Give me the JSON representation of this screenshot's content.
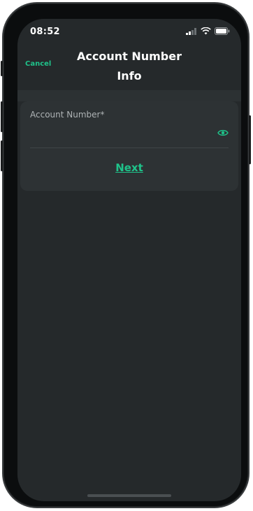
{
  "status_bar": {
    "time": "08:52"
  },
  "header": {
    "cancel_label": "Cancel",
    "title_line1": "Account Number",
    "title_line2": "Info"
  },
  "form": {
    "account_number_label": "Account Number*",
    "account_number_value": "",
    "next_label": "Next"
  },
  "colors": {
    "accent": "#1fc28a",
    "background": "#25292b",
    "card": "#2d3234"
  },
  "icons": {
    "visibility": "eye-icon",
    "signal": "cellular-signal-icon",
    "wifi": "wifi-icon",
    "battery": "battery-icon"
  }
}
